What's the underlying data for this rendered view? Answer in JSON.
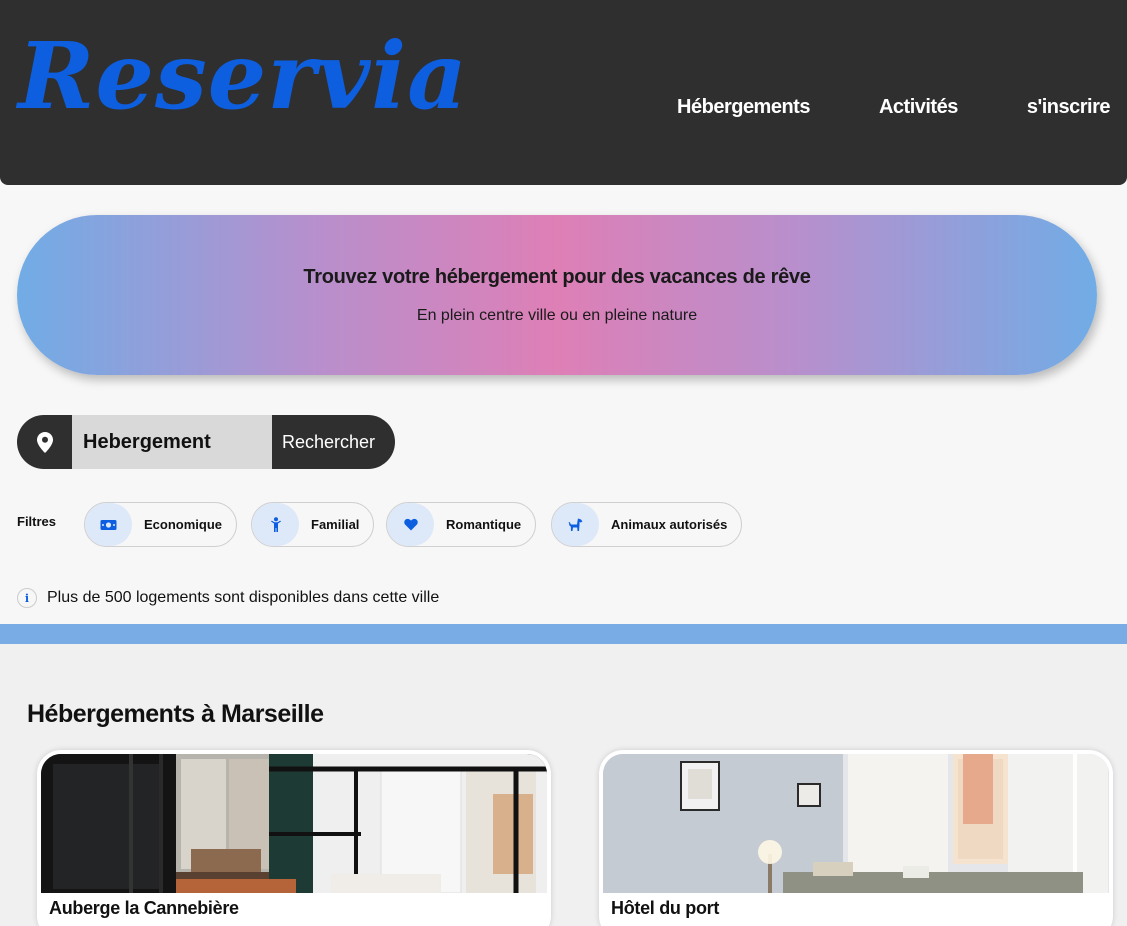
{
  "brand": {
    "logo": "Reservia",
    "color": "#0d5fe0"
  },
  "nav": {
    "items": [
      "Hébergements",
      "Activités",
      "s'inscrire"
    ]
  },
  "hero": {
    "title": "Trouvez votre hébergement pour des vacances de rêve",
    "subtitle": "En plein centre ville ou en pleine nature"
  },
  "search": {
    "icon": "location-pin-icon",
    "value": "Hebergement",
    "button": "Rechercher"
  },
  "filters": {
    "label": "Filtres",
    "items": [
      {
        "label": "Economique",
        "icon": "money-icon"
      },
      {
        "label": "Familial",
        "icon": "child-icon"
      },
      {
        "label": "Romantique",
        "icon": "heart-icon"
      },
      {
        "label": "Animaux autorisés",
        "icon": "dog-icon"
      }
    ]
  },
  "info": {
    "icon": "info-icon",
    "text": "Plus de 500 logements sont disponibles dans cette ville"
  },
  "section": {
    "title": "Hébergements à Marseille",
    "cards": [
      {
        "name": "Auberge la Cannebière"
      },
      {
        "name": "Hôtel du port"
      }
    ]
  }
}
